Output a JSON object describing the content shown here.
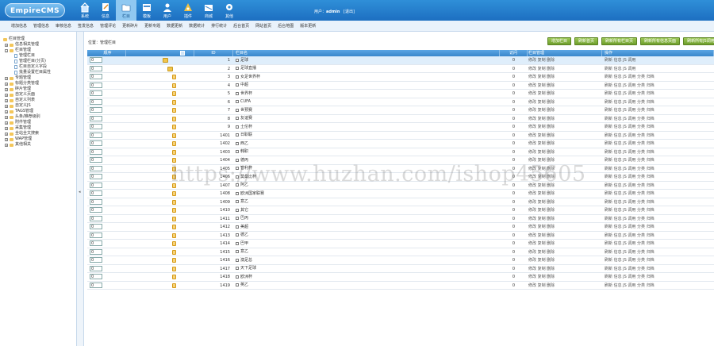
{
  "app": {
    "logo": "EmpireCMS",
    "user_label": "用户：",
    "username": "admin",
    "logout": "[退出]"
  },
  "nav": [
    {
      "label": "系统",
      "icon": "home-icon"
    },
    {
      "label": "信息",
      "icon": "edit-icon"
    },
    {
      "label": "栏目",
      "icon": "folder-icon"
    },
    {
      "label": "模板",
      "icon": "template-icon"
    },
    {
      "label": "用户",
      "icon": "user-icon"
    },
    {
      "label": "插件",
      "icon": "plugin-icon"
    },
    {
      "label": "商城",
      "icon": "shop-icon"
    },
    {
      "label": "其他",
      "icon": "gear-icon"
    }
  ],
  "subnav": [
    "增加信息",
    "管理信息",
    "审核信息",
    "签发信息",
    "管理评论",
    "更新碎片",
    "更新专题",
    "数据更新",
    "数据统计",
    "排行统计",
    "后台首页",
    "网站首页",
    "后台地图",
    "版本更新"
  ],
  "sidebar": [
    {
      "label": "栏目管理",
      "level": 0,
      "type": "root"
    },
    {
      "label": "信息相关管理",
      "level": 1,
      "type": "collapsed"
    },
    {
      "label": "栏目管理",
      "level": 1,
      "type": "expanded"
    },
    {
      "label": "管理栏目",
      "level": 2,
      "type": "doc"
    },
    {
      "label": "管理栏目(分页)",
      "level": 2,
      "type": "doc"
    },
    {
      "label": "栏目自定义字段",
      "level": 2,
      "type": "doc"
    },
    {
      "label": "批量设置栏目属性",
      "level": 2,
      "type": "doc"
    },
    {
      "label": "专题管理",
      "level": 1,
      "type": "collapsed"
    },
    {
      "label": "标题分类管理",
      "level": 1,
      "type": "collapsed"
    },
    {
      "label": "碎片管理",
      "level": 1,
      "type": "collapsed"
    },
    {
      "label": "自定义页面",
      "level": 1,
      "type": "collapsed"
    },
    {
      "label": "自定义列表",
      "level": 1,
      "type": "collapsed"
    },
    {
      "label": "自定义JS",
      "level": 1,
      "type": "collapsed"
    },
    {
      "label": "TAGS管理",
      "level": 1,
      "type": "collapsed"
    },
    {
      "label": "头条/推荐级别",
      "level": 1,
      "type": "collapsed"
    },
    {
      "label": "附件管理",
      "level": 1,
      "type": "collapsed"
    },
    {
      "label": "采集管理",
      "level": 1,
      "type": "collapsed"
    },
    {
      "label": "全站全文搜索",
      "level": 1,
      "type": "collapsed"
    },
    {
      "label": "WAP管理",
      "level": 1,
      "type": "collapsed"
    },
    {
      "label": "其他相关",
      "level": 1,
      "type": "collapsed"
    }
  ],
  "location": "位置：管理栏目",
  "actions": [
    "增加栏目",
    "刷新首页",
    "刷新所有栏目页",
    "刷新所有信息页面",
    "刷新所有JS调用"
  ],
  "table": {
    "headers": {
      "order": "顺序",
      "id": "ID",
      "name": "栏目名",
      "visits": "访问",
      "manage": "栏目管理",
      "ops": "操作"
    },
    "manage_ops": "修改 复制 删除",
    "rows": [
      {
        "order": "0",
        "id": "1",
        "name": "足球",
        "visits": "0",
        "icon": "folder",
        "indent": 0,
        "ops": "刷新 信息 JS 调用"
      },
      {
        "order": "0",
        "id": "2",
        "name": "足球直播",
        "visits": "0",
        "icon": "folder",
        "indent": 1,
        "ops": "刷新 信息 JS 调用"
      },
      {
        "order": "0",
        "id": "3",
        "name": "女足世界杯",
        "visits": "0",
        "icon": "file",
        "indent": 2,
        "ops": "刷新 信息 JS 调用 分类 归档"
      },
      {
        "order": "0",
        "id": "4",
        "name": "中超",
        "visits": "0",
        "icon": "file",
        "indent": 2,
        "ops": "刷新 信息 JS 调用 分类 归档"
      },
      {
        "order": "0",
        "id": "5",
        "name": "世界杯",
        "visits": "0",
        "icon": "file",
        "indent": 2,
        "ops": "刷新 信息 JS 调用 分类 归档"
      },
      {
        "order": "0",
        "id": "6",
        "name": "CUFA",
        "visits": "0",
        "icon": "file",
        "indent": 2,
        "ops": "刷新 信息 JS 调用 分类 归档"
      },
      {
        "order": "0",
        "id": "7",
        "name": "世预赛",
        "visits": "0",
        "icon": "file",
        "indent": 2,
        "ops": "刷新 信息 JS 调用 分类 归档"
      },
      {
        "order": "0",
        "id": "8",
        "name": "友谊赛",
        "visits": "0",
        "icon": "file",
        "indent": 2,
        "ops": "刷新 信息 JS 调用 分类 归档"
      },
      {
        "order": "0",
        "id": "9",
        "name": "土伦杯",
        "visits": "0",
        "icon": "file",
        "indent": 2,
        "ops": "刷新 信息 JS 调用 分类 归档"
      },
      {
        "order": "0",
        "id": "1401",
        "name": "日职联",
        "visits": "0",
        "icon": "file",
        "indent": 2,
        "ops": "刷新 信息 JS 调用 分类 归档"
      },
      {
        "order": "0",
        "id": "1402",
        "name": "西乙",
        "visits": "0",
        "icon": "file",
        "indent": 2,
        "ops": "刷新 信息 JS 调用 分类 归档"
      },
      {
        "order": "0",
        "id": "1403",
        "name": "韩职",
        "visits": "0",
        "icon": "file",
        "indent": 2,
        "ops": "刷新 信息 JS 调用 分类 归档"
      },
      {
        "order": "0",
        "id": "1404",
        "name": "德丙",
        "visits": "0",
        "icon": "file",
        "indent": 2,
        "ops": "刷新 信息 JS 调用 分类 归档"
      },
      {
        "order": "0",
        "id": "1405",
        "name": "智利杯",
        "visits": "0",
        "icon": "file",
        "indent": 2,
        "ops": "刷新 信息 JS 调用 分类 归档"
      },
      {
        "order": "0",
        "id": "1406",
        "name": "莫桑比杯",
        "visits": "0",
        "icon": "file",
        "indent": 2,
        "ops": "刷新 信息 JS 调用 分类 归档"
      },
      {
        "order": "0",
        "id": "1407",
        "name": "阿乙",
        "visits": "0",
        "icon": "file",
        "indent": 2,
        "ops": "刷新 信息 JS 调用 分类 归档"
      },
      {
        "order": "0",
        "id": "1408",
        "name": "欧洲国家联赛",
        "visits": "0",
        "icon": "file",
        "indent": 2,
        "ops": "刷新 信息 JS 调用 分类 归档"
      },
      {
        "order": "0",
        "id": "1409",
        "name": "意乙",
        "visits": "0",
        "icon": "file",
        "indent": 2,
        "ops": "刷新 信息 JS 调用 分类 归档"
      },
      {
        "order": "0",
        "id": "1410",
        "name": "其它",
        "visits": "0",
        "icon": "file",
        "indent": 2,
        "ops": "刷新 信息 JS 调用 分类 归档"
      },
      {
        "order": "0",
        "id": "1411",
        "name": "巴丙",
        "visits": "0",
        "icon": "file",
        "indent": 2,
        "ops": "刷新 信息 JS 调用 分类 归档"
      },
      {
        "order": "0",
        "id": "1412",
        "name": "美超",
        "visits": "0",
        "icon": "file",
        "indent": 2,
        "ops": "刷新 信息 JS 调用 分类 归档"
      },
      {
        "order": "0",
        "id": "1413",
        "name": "德乙",
        "visits": "0",
        "icon": "file",
        "indent": 2,
        "ops": "刷新 信息 JS 调用 分类 归档"
      },
      {
        "order": "0",
        "id": "1414",
        "name": "巴甲",
        "visits": "0",
        "icon": "file",
        "indent": 2,
        "ops": "刷新 信息 JS 调用 分类 归档"
      },
      {
        "order": "0",
        "id": "1415",
        "name": "意乙",
        "visits": "0",
        "icon": "file",
        "indent": 2,
        "ops": "刷新 信息 JS 调用 分类 归档"
      },
      {
        "order": "0",
        "id": "1416",
        "name": "澳足总",
        "visits": "0",
        "icon": "file",
        "indent": 2,
        "ops": "刷新 信息 JS 调用 分类 归档"
      },
      {
        "order": "0",
        "id": "1417",
        "name": "天下足球",
        "visits": "0",
        "icon": "file",
        "indent": 2,
        "ops": "刷新 信息 JS 调用 分类 归档"
      },
      {
        "order": "0",
        "id": "1418",
        "name": "欧洲杯",
        "visits": "0",
        "icon": "file",
        "indent": 2,
        "ops": "刷新 信息 JS 调用 分类 归档"
      },
      {
        "order": "0",
        "id": "1419",
        "name": "英乙",
        "visits": "0",
        "icon": "file",
        "indent": 2,
        "ops": "刷新 信息 JS 调用 分类 归档"
      }
    ]
  },
  "watermark": "https://www.huzhan.com/ishop45605",
  "colors": {
    "header": "#2f8fd8",
    "table_head": "#4a97d8",
    "action_button": "#7fb03c",
    "highlight_row": "#dfeefb"
  }
}
